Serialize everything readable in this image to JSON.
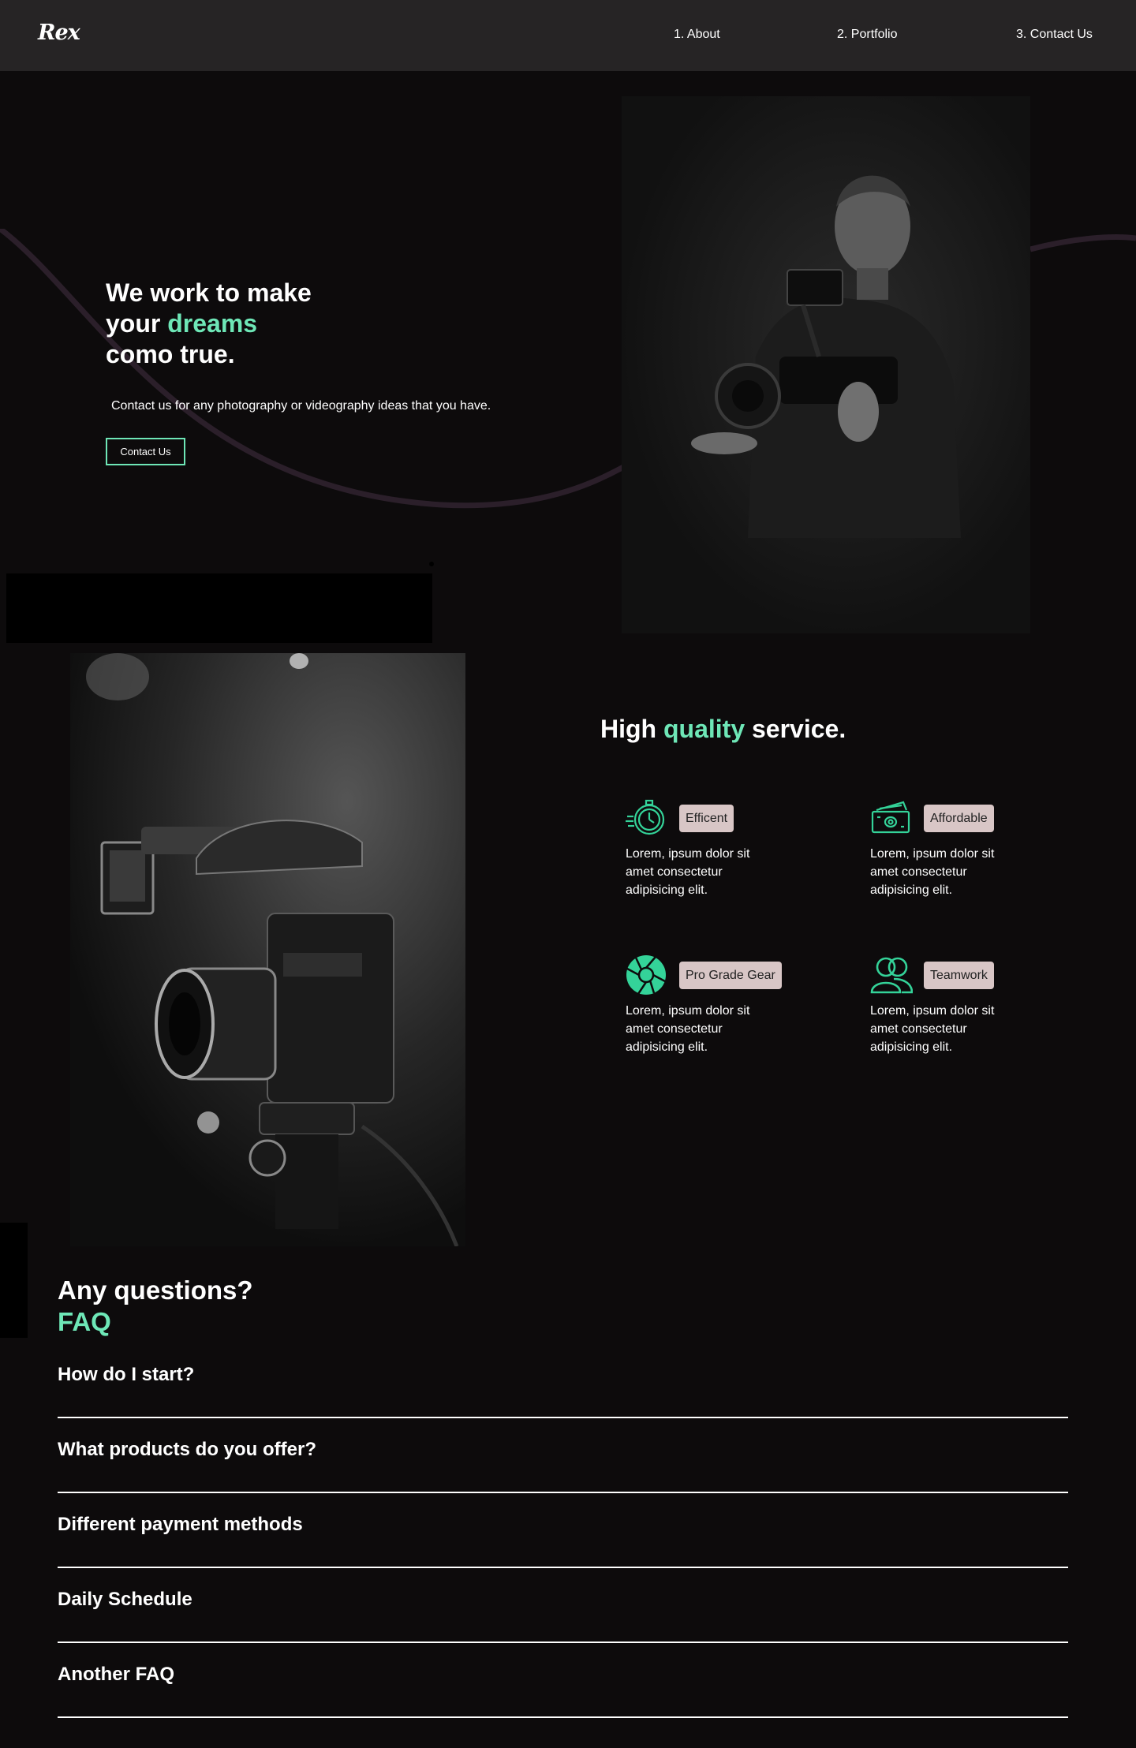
{
  "nav": {
    "logo": "Rex",
    "links": [
      "1. About",
      "2. Portfolio",
      "3. Contact Us"
    ]
  },
  "hero": {
    "title_line1": "We work to make",
    "title_line2_prefix": "your ",
    "title_line2_accent": "dreams",
    "title_line3": "como true.",
    "subtitle": "Contact us for any photography or videography ideas that you have.",
    "button": "Contact Us"
  },
  "service": {
    "title_prefix": "High ",
    "title_accent": "quality",
    "title_suffix": " service.",
    "features": [
      {
        "label": "Efficent",
        "icon": "stopwatch-icon",
        "desc": "Lorem, ipsum dolor sit amet consectetur adipisicing elit."
      },
      {
        "label": "Affordable",
        "icon": "money-icon",
        "desc": "Lorem, ipsum dolor sit amet consectetur adipisicing elit."
      },
      {
        "label": "Pro Grade Gear",
        "icon": "aperture-icon",
        "desc": "Lorem, ipsum dolor sit amet consectetur adipisicing elit."
      },
      {
        "label": "Teamwork",
        "icon": "team-icon",
        "desc": "Lorem, ipsum dolor sit amet consectetur adipisicing elit."
      }
    ]
  },
  "faq": {
    "title": "Any questions?",
    "subtitle": "FAQ",
    "items": [
      "How do I start?",
      "What products do you offer?",
      "Different payment methods",
      "Daily Schedule",
      "Another FAQ"
    ]
  },
  "colors": {
    "accent": "#6ee7b7",
    "icon_green": "#34d399",
    "background": "#0d0b0c",
    "nav_bg": "#262425",
    "badge_bg": "#d8c6c6"
  }
}
